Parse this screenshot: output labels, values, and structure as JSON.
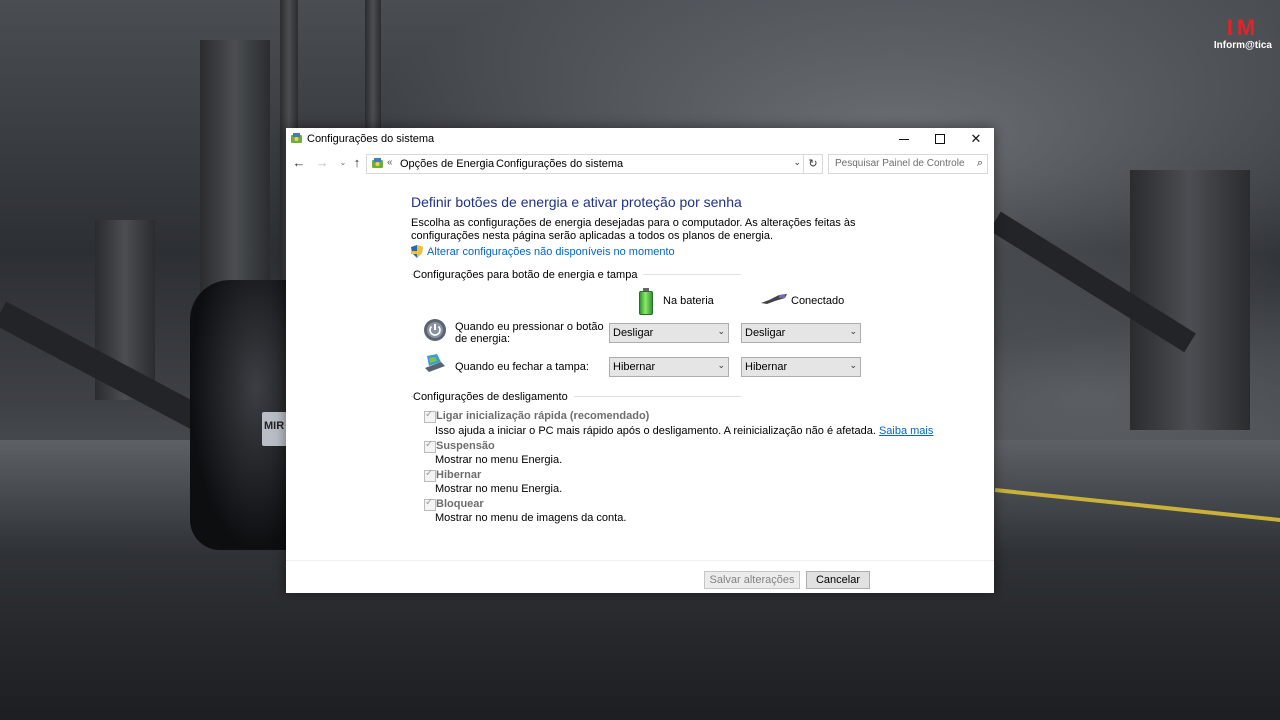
{
  "branding": {
    "mark": "IM",
    "text": "Inform@tica"
  },
  "wallpaper": {
    "plate_text": "MIR"
  },
  "window": {
    "title": "Configurações do sistema",
    "controls": {
      "close": "✕"
    }
  },
  "nav": {
    "back": "←",
    "forward": "→",
    "recent": "⌄",
    "up": "↑",
    "address_overflow": "«",
    "breadcrumbs": [
      "Opções de Energia",
      "Configurações do sistema"
    ],
    "separator": "›",
    "dropdown": "⌄",
    "refresh": "↻",
    "search": {
      "placeholder": "Pesquisar Painel de Controle",
      "icon": "⌕"
    }
  },
  "main": {
    "heading": "Definir botões de energia e ativar proteção por senha",
    "intro": "Escolha as configurações de energia desejadas para o computador. As alterações feitas às configurações nesta página serão aplicadas a todos os planos de energia.",
    "change_link": "Alterar configurações não disponíveis no momento",
    "power_group": {
      "label": "Configurações para botão de energia e tampa",
      "columns": {
        "battery": "Na bateria",
        "plugged": "Conectado"
      },
      "rows": [
        {
          "label": "Quando eu pressionar o botão de energia:",
          "battery": "Desligar",
          "plugged": "Desligar",
          "icon": "power-button-icon"
        },
        {
          "label": "Quando eu fechar a tampa:",
          "battery": "Hibernar",
          "plugged": "Hibernar",
          "icon": "laptop-lid-icon"
        }
      ],
      "select_arrow": "⌄"
    },
    "shutdown_group": {
      "label": "Configurações de desligamento",
      "items": [
        {
          "title": "Ligar inicialização rápida (recomendado)",
          "desc": "Isso ajuda a iniciar o PC mais rápido após o desligamento. A reinicialização não é afetada.",
          "link": "Saiba mais",
          "checked": true
        },
        {
          "title": "Suspensão",
          "desc": "Mostrar no menu Energia.",
          "checked": true
        },
        {
          "title": "Hibernar",
          "desc": "Mostrar no menu Energia.",
          "checked": true
        },
        {
          "title": "Bloquear",
          "desc": "Mostrar no menu de imagens da conta.",
          "checked": true
        }
      ]
    }
  },
  "footer": {
    "save": "Salvar alterações",
    "cancel": "Cancelar"
  }
}
